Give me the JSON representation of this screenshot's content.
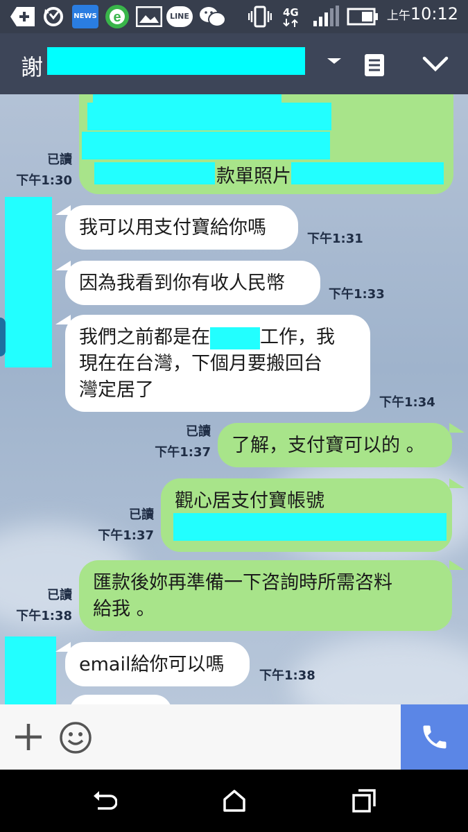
{
  "status_bar": {
    "news_label": "NEWS",
    "line_label": "LINE",
    "network": "4G",
    "ampm": "上午",
    "time": "10:12"
  },
  "header": {
    "title": "謝"
  },
  "messages": {
    "m0_partial": "款單照片",
    "m0_read": "已讀",
    "m0_time": "下午1:30",
    "m1_text": "我可以用支付寶給你嗎",
    "m1_time": "下午1:31",
    "m2_text": "因為我看到你有收人民幣",
    "m2_time": "下午1:33",
    "m3_line1a": "我們之前都是在",
    "m3_line1b": "工作，我",
    "m3_line2": "現在在台灣，下個月要搬回台",
    "m3_line3": "灣定居了",
    "m3_time": "下午1:34",
    "m4_text": "了解，支付寶可以的 。",
    "m4_read": "已讀",
    "m4_time": "下午1:37",
    "m5_text": "觀心居支付寶帳號",
    "m5_read": "已讀",
    "m5_time": "下午1:37",
    "m6_line1": "匯款後妳再準備一下咨詢時所需咨料",
    "m6_line2": "給我 。",
    "m6_read": "已讀",
    "m6_time": "下午1:38",
    "m7_text": "email給你可以嗎",
    "m7_time": "下午1:38"
  },
  "icons": {
    "add": "plus-icon",
    "emoji": "smiley-icon",
    "call": "phone-icon",
    "back": "back-icon",
    "home": "home-icon",
    "recents": "recents-icon"
  },
  "colors": {
    "incoming_bubble": "#ffffff",
    "outgoing_bubble": "#a8e48a",
    "redaction": "#22ffff",
    "call_button": "#5b86e6",
    "header_bg": "#3d4558"
  }
}
